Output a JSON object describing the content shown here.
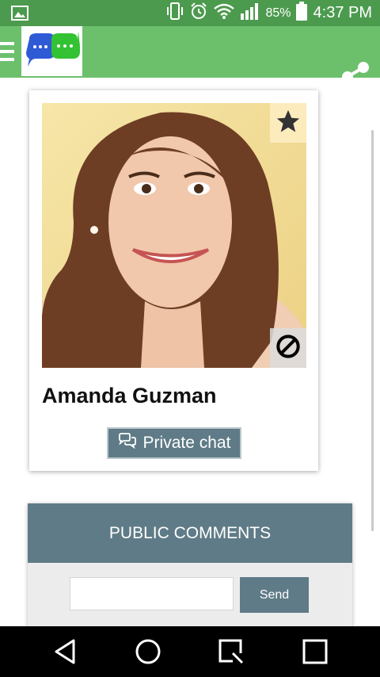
{
  "status_bar": {
    "battery_percent": "85%",
    "time": "4:37 PM",
    "icons": [
      "image-notification-icon",
      "vibrate-icon",
      "alarm-icon",
      "wifi-icon",
      "signal-icon",
      "battery-icon"
    ]
  },
  "app_bar": {
    "icons": [
      "menu-icon",
      "app-logo",
      "share-icon"
    ]
  },
  "profile": {
    "name": "Amanda Guzman",
    "private_chat_label": "Private chat",
    "icons": [
      "star-icon",
      "block-icon",
      "chat-bubbles-icon"
    ]
  },
  "comments": {
    "header": "PUBLIC COMMENTS",
    "input_value": "",
    "send_label": "Send"
  },
  "nav_bar": {
    "icons": [
      "back-icon",
      "home-icon",
      "recents-icon",
      "overview-icon"
    ]
  },
  "colors": {
    "status_bar": "#4c9a4e",
    "app_bar": "#6cc06c",
    "accent": "#5f7b87",
    "comments_bg": "#ececec"
  }
}
